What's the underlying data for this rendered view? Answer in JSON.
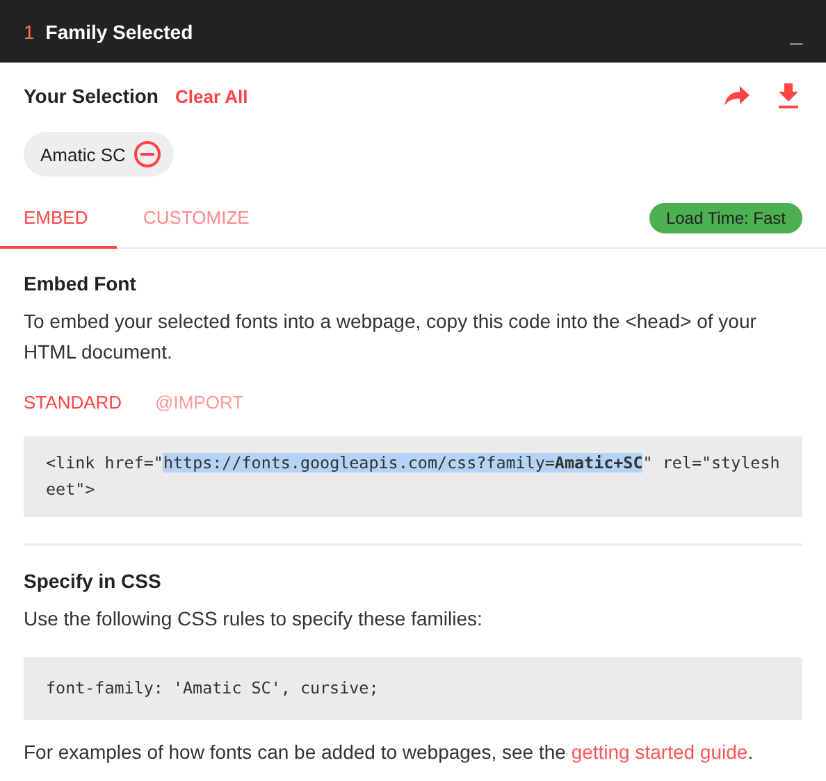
{
  "header": {
    "count": "1",
    "title": "Family Selected",
    "minimize": "_"
  },
  "selection": {
    "label": "Your Selection",
    "clear": "Clear All",
    "families": [
      "Amatic SC"
    ]
  },
  "tabs": [
    {
      "label": "EMBED",
      "selected": true
    },
    {
      "label": "CUSTOMIZE",
      "selected": false
    }
  ],
  "load_time": "Load Time: Fast",
  "embed": {
    "title": "Embed Font",
    "text": "To embed your selected fonts into a webpage, copy this code into the <head> of your HTML document.",
    "modes": [
      {
        "label": "STANDARD",
        "selected": true
      },
      {
        "label": "@IMPORT",
        "selected": false
      }
    ],
    "code": {
      "before": "<link href=\"",
      "selected_text": "https://fonts.googleapis.com/css?family=**Amatic+SC**",
      "after": "\" rel=\"stylesheet\">"
    }
  },
  "css": {
    "title": "Specify in CSS",
    "text": "Use the following CSS rules to specify these families:",
    "code": "font-family: 'Amatic SC', cursive;"
  },
  "footer": {
    "text": "For examples of how fonts can be added to webpages, see the",
    "link": "getting started guide",
    "after": "."
  }
}
